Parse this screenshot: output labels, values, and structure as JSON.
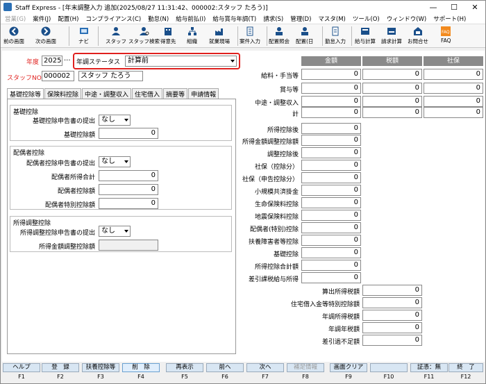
{
  "window": {
    "title": "Staff Express - [年末調整入力 追加(2025/08/27 11:31:42、000002:スタッフ たろう)]",
    "minimize": "—",
    "maximize": "☐",
    "close": "✕"
  },
  "menu": [
    "営業(G)",
    "案件(J)",
    "配置(H)",
    "コンプライアンス(C)",
    "勤怠(N)",
    "給与前払(I)",
    "給与賞与年調(T)",
    "請求(S)",
    "管理(D)",
    "マスタ(M)",
    "ツール(O)",
    "ウィンドウ(W)",
    "サポート(H)"
  ],
  "toolbar": {
    "back": "前の画面",
    "next": "次の画面",
    "nav": "ナビ",
    "staff": "スタッフ",
    "staff_search": "スタッフ検索",
    "client": "得意先",
    "org": "組織",
    "site": "就業現場",
    "job_entry": "案件入力",
    "haichi_shokai": "配置照会",
    "haichi_nichi": "配置(日",
    "kintai": "勤怠入力",
    "kyuyo": "給与計算",
    "seikyu": "請求計算",
    "inquiry": "お問合せ",
    "faq": "FAQ"
  },
  "form": {
    "year_label": "年度",
    "year_value": "2025",
    "year_dots": "...",
    "status_label": "年調ステータス",
    "status_value": "計算前",
    "staff_label": "スタッフNO",
    "staff_no": "000002",
    "staff_name": "スタッフ たろう"
  },
  "tabs": [
    "基礎控除等",
    "保険料控除",
    "中途・調整収入",
    "住宅借入",
    "摘要等",
    "申請情報"
  ],
  "kiso": {
    "title": "基礎控除",
    "submit_label": "基礎控除申告書の提出",
    "submit_value": "なし",
    "amount_label": "基礎控除額",
    "amount_value": "0"
  },
  "haigusha": {
    "title": "配偶者控除",
    "submit_label": "配偶者控除申告書の提出",
    "submit_value": "なし",
    "income_label": "配偶者所得合計",
    "income_value": "0",
    "deduct_label": "配偶者控除額",
    "deduct_value": "0",
    "special_label": "配偶者特別控除額",
    "special_value": "0"
  },
  "shotoku": {
    "title": "所得調整控除",
    "submit_label": "所得調整控除申告書の提出",
    "submit_value": "なし",
    "amount_label": "所得金額調整控除額",
    "amount_value": ""
  },
  "summary": {
    "headers": [
      "金額",
      "税額",
      "社保"
    ],
    "top_rows": [
      {
        "label": "給料・手当等",
        "v": [
          "0",
          "0",
          "0"
        ]
      },
      {
        "label": "賞与等",
        "v": [
          "0",
          "0",
          "0"
        ]
      },
      {
        "label": "中途・調整収入",
        "v": [
          "0",
          "0",
          "0"
        ]
      },
      {
        "label": "計",
        "v": [
          "0",
          "0",
          "0"
        ]
      }
    ],
    "mid_rows": [
      {
        "label": "所得控除後",
        "v": "0"
      },
      {
        "label": "所得金額調整控除額",
        "v": "0"
      },
      {
        "label": "調整控除後",
        "v": "0"
      },
      {
        "label": "社保（控除分）",
        "v": "0"
      },
      {
        "label": "社保（申告控除分）",
        "v": "0"
      },
      {
        "label": "小規模共済掛金",
        "v": "0"
      },
      {
        "label": "生命保険料控除",
        "v": "0"
      },
      {
        "label": "地震保険料控除",
        "v": "0"
      },
      {
        "label": "配偶者(特別)控除",
        "v": "0"
      },
      {
        "label": "扶養障害者等控除",
        "v": "0"
      },
      {
        "label": "基礎控除",
        "v": "0"
      },
      {
        "label": "所得控除合計額",
        "v": "0"
      },
      {
        "label": "差引課税給与所得",
        "v": "0"
      }
    ],
    "tax_rows": [
      {
        "label": "算出所得税額",
        "v": "0"
      },
      {
        "label": "住宅借入金等特別控除額",
        "v": "0"
      },
      {
        "label": "年調所得税額",
        "v": "0"
      },
      {
        "label": "年調年税額",
        "v": "0"
      },
      {
        "label": "差引過不足額",
        "v": "0"
      }
    ]
  },
  "fkeys": [
    {
      "label": "ヘルプ",
      "key": "F1"
    },
    {
      "label": "登　録",
      "key": "F2"
    },
    {
      "label": "扶養控除等",
      "key": "F3"
    },
    {
      "label": "削　除",
      "key": "F4"
    },
    {
      "label": "再表示",
      "key": "F5"
    },
    {
      "label": "前へ",
      "key": "F6"
    },
    {
      "label": "次へ",
      "key": "F7"
    },
    {
      "label": "補足情報",
      "key": "F8"
    },
    {
      "label": "画面クリア",
      "key": "F9"
    },
    {
      "label": "",
      "key": "F10"
    },
    {
      "label": "証憑：無",
      "key": "F11"
    },
    {
      "label": "終　了",
      "key": "F12"
    }
  ]
}
